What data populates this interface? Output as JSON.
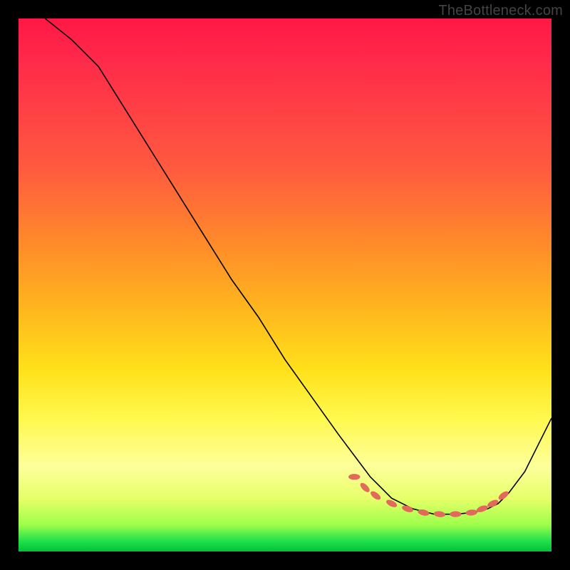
{
  "watermark": "TheBottleneck.com",
  "chart_data": {
    "type": "line",
    "title": "",
    "xlabel": "",
    "ylabel": "",
    "xlim": [
      0,
      100
    ],
    "ylim": [
      0,
      100
    ],
    "series": [
      {
        "name": "curve",
        "x": [
          5,
          10,
          15,
          20,
          25,
          30,
          35,
          40,
          45,
          50,
          55,
          60,
          63,
          66,
          68,
          70,
          72,
          74,
          76,
          78,
          80,
          82,
          84,
          86,
          88,
          90,
          92,
          95,
          100
        ],
        "y": [
          100,
          96,
          91,
          83,
          75,
          67,
          59,
          51,
          44,
          36,
          29,
          22,
          18,
          14,
          12,
          10,
          9,
          8,
          7.5,
          7,
          7,
          7,
          7.2,
          7.5,
          8,
          9,
          11,
          15,
          25
        ]
      }
    ],
    "markers": {
      "name": "dotted-region",
      "color": "#e16a5a",
      "points_x": [
        63,
        65,
        67,
        70,
        73,
        76,
        79,
        82,
        85,
        87,
        89,
        91
      ],
      "points_y": [
        14,
        12,
        10.5,
        9,
        8,
        7.3,
        7,
        7,
        7.3,
        8,
        9,
        10.5
      ]
    }
  }
}
